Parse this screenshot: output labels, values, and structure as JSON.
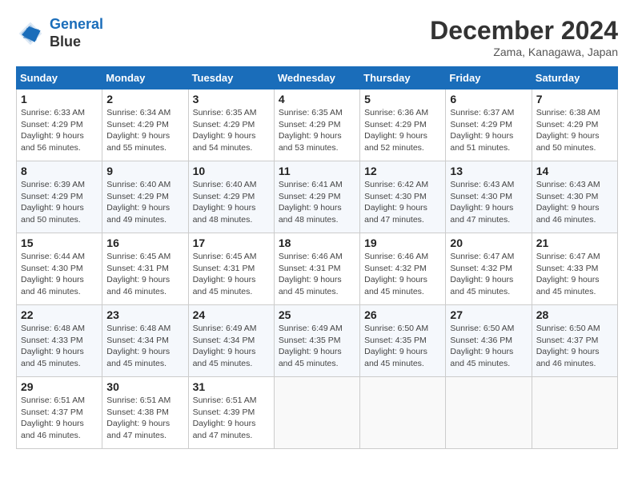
{
  "header": {
    "logo_line1": "General",
    "logo_line2": "Blue",
    "month_title": "December 2024",
    "subtitle": "Zama, Kanagawa, Japan"
  },
  "weekdays": [
    "Sunday",
    "Monday",
    "Tuesday",
    "Wednesday",
    "Thursday",
    "Friday",
    "Saturday"
  ],
  "weeks": [
    [
      {
        "day": 1,
        "sunrise": "6:33 AM",
        "sunset": "4:29 PM",
        "daylight": "9 hours and 56 minutes."
      },
      {
        "day": 2,
        "sunrise": "6:34 AM",
        "sunset": "4:29 PM",
        "daylight": "9 hours and 55 minutes."
      },
      {
        "day": 3,
        "sunrise": "6:35 AM",
        "sunset": "4:29 PM",
        "daylight": "9 hours and 54 minutes."
      },
      {
        "day": 4,
        "sunrise": "6:35 AM",
        "sunset": "4:29 PM",
        "daylight": "9 hours and 53 minutes."
      },
      {
        "day": 5,
        "sunrise": "6:36 AM",
        "sunset": "4:29 PM",
        "daylight": "9 hours and 52 minutes."
      },
      {
        "day": 6,
        "sunrise": "6:37 AM",
        "sunset": "4:29 PM",
        "daylight": "9 hours and 51 minutes."
      },
      {
        "day": 7,
        "sunrise": "6:38 AM",
        "sunset": "4:29 PM",
        "daylight": "9 hours and 50 minutes."
      }
    ],
    [
      {
        "day": 8,
        "sunrise": "6:39 AM",
        "sunset": "4:29 PM",
        "daylight": "9 hours and 50 minutes."
      },
      {
        "day": 9,
        "sunrise": "6:40 AM",
        "sunset": "4:29 PM",
        "daylight": "9 hours and 49 minutes."
      },
      {
        "day": 10,
        "sunrise": "6:40 AM",
        "sunset": "4:29 PM",
        "daylight": "9 hours and 48 minutes."
      },
      {
        "day": 11,
        "sunrise": "6:41 AM",
        "sunset": "4:29 PM",
        "daylight": "9 hours and 48 minutes."
      },
      {
        "day": 12,
        "sunrise": "6:42 AM",
        "sunset": "4:30 PM",
        "daylight": "9 hours and 47 minutes."
      },
      {
        "day": 13,
        "sunrise": "6:43 AM",
        "sunset": "4:30 PM",
        "daylight": "9 hours and 47 minutes."
      },
      {
        "day": 14,
        "sunrise": "6:43 AM",
        "sunset": "4:30 PM",
        "daylight": "9 hours and 46 minutes."
      }
    ],
    [
      {
        "day": 15,
        "sunrise": "6:44 AM",
        "sunset": "4:30 PM",
        "daylight": "9 hours and 46 minutes."
      },
      {
        "day": 16,
        "sunrise": "6:45 AM",
        "sunset": "4:31 PM",
        "daylight": "9 hours and 46 minutes."
      },
      {
        "day": 17,
        "sunrise": "6:45 AM",
        "sunset": "4:31 PM",
        "daylight": "9 hours and 45 minutes."
      },
      {
        "day": 18,
        "sunrise": "6:46 AM",
        "sunset": "4:31 PM",
        "daylight": "9 hours and 45 minutes."
      },
      {
        "day": 19,
        "sunrise": "6:46 AM",
        "sunset": "4:32 PM",
        "daylight": "9 hours and 45 minutes."
      },
      {
        "day": 20,
        "sunrise": "6:47 AM",
        "sunset": "4:32 PM",
        "daylight": "9 hours and 45 minutes."
      },
      {
        "day": 21,
        "sunrise": "6:47 AM",
        "sunset": "4:33 PM",
        "daylight": "9 hours and 45 minutes."
      }
    ],
    [
      {
        "day": 22,
        "sunrise": "6:48 AM",
        "sunset": "4:33 PM",
        "daylight": "9 hours and 45 minutes."
      },
      {
        "day": 23,
        "sunrise": "6:48 AM",
        "sunset": "4:34 PM",
        "daylight": "9 hours and 45 minutes."
      },
      {
        "day": 24,
        "sunrise": "6:49 AM",
        "sunset": "4:34 PM",
        "daylight": "9 hours and 45 minutes."
      },
      {
        "day": 25,
        "sunrise": "6:49 AM",
        "sunset": "4:35 PM",
        "daylight": "9 hours and 45 minutes."
      },
      {
        "day": 26,
        "sunrise": "6:50 AM",
        "sunset": "4:35 PM",
        "daylight": "9 hours and 45 minutes."
      },
      {
        "day": 27,
        "sunrise": "6:50 AM",
        "sunset": "4:36 PM",
        "daylight": "9 hours and 45 minutes."
      },
      {
        "day": 28,
        "sunrise": "6:50 AM",
        "sunset": "4:37 PM",
        "daylight": "9 hours and 46 minutes."
      }
    ],
    [
      {
        "day": 29,
        "sunrise": "6:51 AM",
        "sunset": "4:37 PM",
        "daylight": "9 hours and 46 minutes."
      },
      {
        "day": 30,
        "sunrise": "6:51 AM",
        "sunset": "4:38 PM",
        "daylight": "9 hours and 47 minutes."
      },
      {
        "day": 31,
        "sunrise": "6:51 AM",
        "sunset": "4:39 PM",
        "daylight": "9 hours and 47 minutes."
      },
      null,
      null,
      null,
      null
    ]
  ]
}
